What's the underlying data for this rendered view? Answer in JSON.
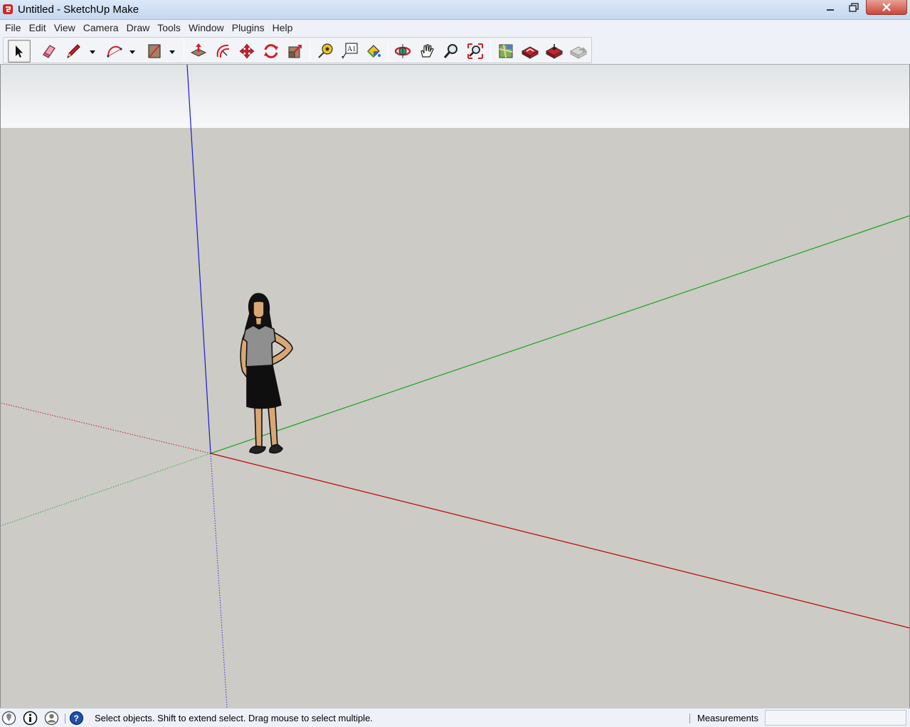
{
  "window": {
    "title": "Untitled - SketchUp Make"
  },
  "menu": [
    "File",
    "Edit",
    "View",
    "Camera",
    "Draw",
    "Tools",
    "Window",
    "Plugins",
    "Help"
  ],
  "toolbar": {
    "tools": [
      {
        "name": "select-tool",
        "icon": "arrow-cursor-icon",
        "active": true
      },
      {
        "name": "eraser-tool",
        "icon": "eraser-icon"
      },
      {
        "name": "line-tool",
        "icon": "pencil-icon"
      },
      {
        "name": "arc-tool",
        "icon": "arc-icon"
      },
      {
        "name": "rectangle-tool",
        "icon": "rectangle-icon"
      },
      {
        "name": "push-pull-tool",
        "icon": "push-pull-icon"
      },
      {
        "name": "offset-tool",
        "icon": "offset-icon"
      },
      {
        "name": "move-tool",
        "icon": "move-icon"
      },
      {
        "name": "rotate-tool",
        "icon": "rotate-icon"
      },
      {
        "name": "scale-tool",
        "icon": "scale-icon"
      },
      {
        "name": "tape-measure-tool",
        "icon": "tape-measure-icon"
      },
      {
        "name": "text-tool",
        "icon": "text-icon"
      },
      {
        "name": "paint-bucket-tool",
        "icon": "paint-bucket-icon"
      },
      {
        "name": "orbit-tool",
        "icon": "orbit-icon"
      },
      {
        "name": "pan-tool",
        "icon": "hand-icon"
      },
      {
        "name": "zoom-tool",
        "icon": "magnifier-icon"
      },
      {
        "name": "zoom-extents-tool",
        "icon": "zoom-extents-icon"
      },
      {
        "name": "add-location-tool",
        "icon": "map-icon"
      },
      {
        "name": "3d-warehouse-tool",
        "icon": "warehouse-icon"
      },
      {
        "name": "get-models-tool",
        "icon": "models-icon"
      },
      {
        "name": "share-model-tool",
        "icon": "share-icon"
      }
    ],
    "text_tool_glyph": "A1"
  },
  "colors": {
    "viewport_bg": "#cccbc6",
    "x_axis": "#c00000",
    "y_axis": "#1aa31a",
    "z_axis": "#1a1acc"
  },
  "status": {
    "message": "Select objects. Shift to extend select. Drag mouse to select multiple.",
    "icons": [
      "geo-location-icon",
      "credits-icon",
      "user-icon",
      "help-icon"
    ],
    "measurements_label": "Measurements",
    "measurements_value": ""
  }
}
